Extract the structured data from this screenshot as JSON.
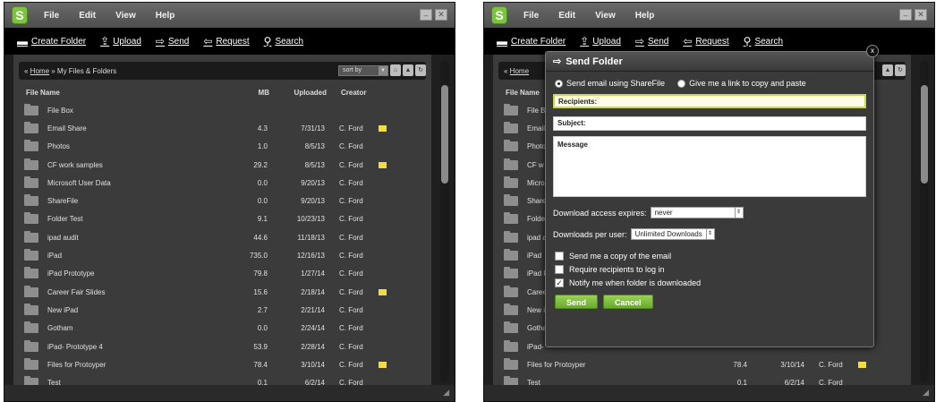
{
  "menu": [
    "File",
    "Edit",
    "View",
    "Help"
  ],
  "toolbar": {
    "create": "Create Folder",
    "upload": "Upload",
    "send": "Send",
    "request": "Request",
    "search": "Search"
  },
  "breadcrumb": {
    "home": "Home",
    "sep": " » ",
    "current": "My Files & Folders",
    "prefix": "« "
  },
  "sort_label": "sort by",
  "columns": {
    "name": "File Name",
    "mb": "MB",
    "uploaded": "Uploaded",
    "creator": "Creator"
  },
  "rows": [
    {
      "name": "File Box",
      "mb": "",
      "up": "",
      "cr": "",
      "note": false,
      "box": true
    },
    {
      "name": "Email Share",
      "mb": "4.3",
      "up": "7/31/13",
      "cr": "C. Ford",
      "note": true
    },
    {
      "name": "Photos",
      "mb": "1.0",
      "up": "8/5/13",
      "cr": "C. Ford",
      "note": false
    },
    {
      "name": "CF work samples",
      "mb": "29.2",
      "up": "8/5/13",
      "cr": "C. Ford",
      "note": true
    },
    {
      "name": "Microsoft User Data",
      "mb": "0.0",
      "up": "9/20/13",
      "cr": "C. Ford",
      "note": false
    },
    {
      "name": "ShareFile",
      "mb": "0.0",
      "up": "9/20/13",
      "cr": "C. Ford",
      "note": false
    },
    {
      "name": "Folder Test",
      "mb": "9.1",
      "up": "10/23/13",
      "cr": "C. Ford",
      "note": false
    },
    {
      "name": "ipad audit",
      "mb": "44.6",
      "up": "11/18/13",
      "cr": "C. Ford",
      "note": false
    },
    {
      "name": "iPad",
      "mb": "735.0",
      "up": "12/16/13",
      "cr": "C. Ford",
      "note": false
    },
    {
      "name": "iPad Prototype",
      "mb": "79.8",
      "up": "1/27/14",
      "cr": "C. Ford",
      "note": false
    },
    {
      "name": "Career Fair Slides",
      "mb": "15.6",
      "up": "2/18/14",
      "cr": "C. Ford",
      "note": true
    },
    {
      "name": "New iPad",
      "mb": "2.7",
      "up": "2/21/14",
      "cr": "C. Ford",
      "note": false
    },
    {
      "name": "Gotham",
      "mb": "0.0",
      "up": "2/24/14",
      "cr": "C. Ford",
      "note": false
    },
    {
      "name": "iPad- Prototype 4",
      "mb": "53.9",
      "up": "2/28/14",
      "cr": "C. Ford",
      "note": false
    },
    {
      "name": "Files for Protoyper",
      "mb": "78.4",
      "up": "3/10/14",
      "cr": "C. Ford",
      "note": true
    },
    {
      "name": "Test",
      "mb": "0.1",
      "up": "6/2/14",
      "cr": "C. Ford",
      "note": false
    }
  ],
  "right_rows": [
    {
      "name": "File Bo",
      "mb": "",
      "up": "",
      "cr": "",
      "note": false,
      "box": true
    },
    {
      "name": "Email",
      "mb": "",
      "up": "",
      "cr": "",
      "note": true
    },
    {
      "name": "Photo",
      "mb": "",
      "up": "",
      "cr": "",
      "note": false
    },
    {
      "name": "CF w",
      "mb": "",
      "up": "",
      "cr": "",
      "note": true
    },
    {
      "name": "Micros",
      "mb": "",
      "up": "",
      "cr": "",
      "note": false
    },
    {
      "name": "Share",
      "mb": "",
      "up": "",
      "cr": "",
      "note": false
    },
    {
      "name": "Folder",
      "mb": "",
      "up": "",
      "cr": "",
      "note": false
    },
    {
      "name": "ipad a",
      "mb": "",
      "up": "",
      "cr": "",
      "note": false
    },
    {
      "name": "iPad",
      "mb": "",
      "up": "",
      "cr": "",
      "note": false
    },
    {
      "name": "iPad P",
      "mb": "",
      "up": "",
      "cr": "",
      "note": false
    },
    {
      "name": "Caree",
      "mb": "",
      "up": "",
      "cr": "",
      "note": true
    },
    {
      "name": "New iF",
      "mb": "",
      "up": "",
      "cr": "",
      "note": false
    },
    {
      "name": "Gotha",
      "mb": "",
      "up": "",
      "cr": "",
      "note": false
    },
    {
      "name": "iPad-",
      "mb": "",
      "up": "",
      "cr": "",
      "note": false
    },
    {
      "name": "Files for Protoyper",
      "mb": "78.4",
      "up": "3/10/14",
      "cr": "C. Ford",
      "note": true
    },
    {
      "name": "Test",
      "mb": "0.1",
      "up": "6/2/14",
      "cr": "C. Ford",
      "note": false
    }
  ],
  "modal": {
    "title": "Send Folder",
    "close": "x",
    "radio_sharefile": "Send email using ShareFile",
    "radio_link": "Give me a link to copy and paste",
    "recipients": "Recipients:",
    "subject": "Subject:",
    "message": "Message",
    "expires_label": "Download access expires:",
    "expires_value": "never",
    "per_user_label": "Downloads per user:",
    "per_user_value": "Unlimited Downloads",
    "chk_copy": "Send me a copy of the email",
    "chk_login": "Require recipients to log in",
    "chk_notify": "Notify me when folder is downloaded",
    "send": "Send",
    "cancel": "Cancel"
  },
  "colors": {
    "accent_green": "#7dc242",
    "note_yellow": "#f2dd3a"
  }
}
